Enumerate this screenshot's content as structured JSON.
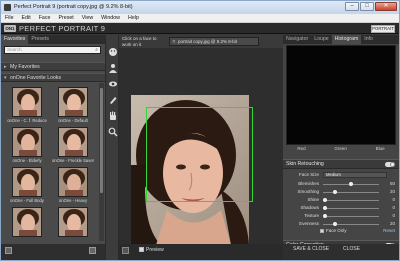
{
  "window": {
    "title": "Perfect Portrait 9 (portrait copy.jpg @ 9.2% 8-bit)",
    "min": "–",
    "max": "□",
    "close": "✕"
  },
  "menu": [
    "File",
    "Edit",
    "Face",
    "Preset",
    "View",
    "Window",
    "Help"
  ],
  "brand": {
    "logo": "ON1",
    "name": "PERFECT PORTRAIT 9",
    "mode": "PORTRAIT"
  },
  "left": {
    "tabs": [
      "Favorites",
      "Presets"
    ],
    "search_placeholder": "Search",
    "sections": {
      "my_favorites": "My Favorites",
      "looks": "onOne Favorite Looks"
    },
    "presets": [
      "onOne - C. f. Reduce",
      "onOne - Default",
      "onOne - Elderly",
      "onOne - Freckle Saver",
      "onOne - Full Body",
      "onOne - Heavy",
      "",
      ""
    ]
  },
  "center": {
    "hint": "Click on a face to work on it",
    "doc_tab": "portrait copy.jpg @ 9.2% 8-bit",
    "preview": "Preview"
  },
  "right": {
    "tabs": [
      "Navigator",
      "Loupe",
      "Histogram",
      "Info"
    ],
    "rgb": [
      "Red",
      "Green",
      "Blue"
    ],
    "skin": {
      "title": "Skin Retouching",
      "face_size_label": "Face Size",
      "face_size_value": "Medium",
      "sliders": [
        {
          "label": "Blemishes",
          "value": "50",
          "level": 0.5
        },
        {
          "label": "Smoothing",
          "value": "20",
          "level": 0.2
        },
        {
          "label": "Shine",
          "value": "0",
          "level": 0.0
        },
        {
          "label": "Shadows",
          "value": "0",
          "level": 0.0
        },
        {
          "label": "Texture",
          "value": "0",
          "level": 0.0
        },
        {
          "label": "Evenness",
          "value": "20",
          "level": 0.2
        }
      ],
      "face_only": "Face Only",
      "reset": "Reset"
    },
    "color": {
      "title": "Color Correction",
      "sliders": [
        {
          "label": "Amount",
          "value": "0",
          "level": 0.0
        },
        {
          "label": "Warmth",
          "value": "10",
          "level": 0.55
        }
      ]
    },
    "buttons": {
      "save": "SAVE & CLOSE",
      "close": "CLOSE"
    }
  }
}
